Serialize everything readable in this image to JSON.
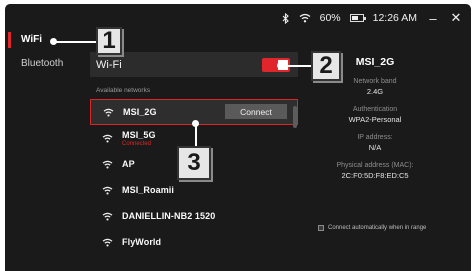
{
  "status": {
    "bluetooth_icon": "bluetooth-icon",
    "wifi_icon": "wifi-icon",
    "battery": "60%",
    "battery_level": 0.6,
    "time": "12:26 AM",
    "minimize": "–",
    "close": "✕"
  },
  "sidebar": {
    "items": [
      {
        "label": "WiFi",
        "active": true
      },
      {
        "label": "Bluetooth",
        "active": false
      }
    ]
  },
  "wifi": {
    "label": "Wi-Fi",
    "toggle_on": true,
    "available_label": "Available networks"
  },
  "networks": [
    {
      "name": "MSI_2G",
      "sub": "",
      "action": "Connect",
      "selected": true
    },
    {
      "name": "MSI_5G",
      "sub": "Connected"
    },
    {
      "name": "AP",
      "sub": ""
    },
    {
      "name": "MSI_Roamii",
      "sub": ""
    },
    {
      "name": "DANIELLIN-NB2 1520",
      "sub": ""
    },
    {
      "name": "FlyWorld",
      "sub": ""
    }
  ],
  "detail": {
    "ssid": "MSI_2G",
    "band_label": "Network band",
    "band": "2.4G",
    "auth_label": "Authentication",
    "auth": "WPA2-Personal",
    "ip_label": "IP address:",
    "ip": "N/A",
    "mac_label": "Physical address (MAC):",
    "mac": "2C:F0:5D:F8:ED:C5",
    "auto_connect": "Connect automatically when in range"
  },
  "callouts": [
    "1",
    "2",
    "3"
  ],
  "colors": {
    "accent": "#e0262a",
    "background": "#1a1a1a"
  }
}
